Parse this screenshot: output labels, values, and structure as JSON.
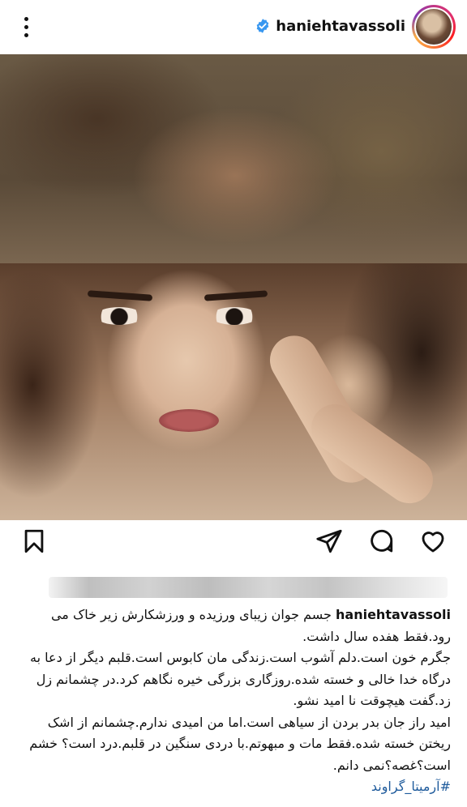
{
  "post": {
    "username": "haniehtavassoli",
    "icons": {
      "more": "more-vertical-icon",
      "verified": "verified-badge-icon",
      "like": "heart-icon",
      "comment": "comment-bubble-icon",
      "share": "send-icon",
      "save": "bookmark-icon"
    },
    "colors": {
      "verified": "#3897f0",
      "hashtag": "#1f5b9c",
      "text": "#111111"
    },
    "caption": {
      "username": "haniehtavassoli",
      "first_line": "جسم جوان زیبای ورزیده و ورزشکارش زیر خاک می رود.فقط هفده سال داشت.",
      "paragraph_1": "جگرم خون است.دلم آشوب است.زندگی مان کابوس است.قلبم دیگر از دعا به درگاه خدا خالی و خسته شده.روزگاری بزرگی خیره نگاهم کرد.در چشمانم زل زد.گفت هیچوقت نا امید نشو.",
      "paragraph_2": "امید راز جان بدر بردن از سیاهی است.اما من امیدی ندارم.چشمانم از اشک ریختن خسته شده.فقط مات و مبهوتم.با دردی سنگین در قلبم.درد است؟ خشم است؟غصه؟نمی دانم.",
      "hashtag": "#آرمیتا_گراوند"
    }
  }
}
